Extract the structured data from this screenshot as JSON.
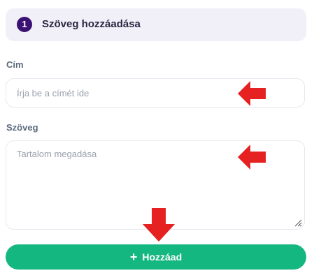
{
  "form": {
    "step_number": "1",
    "title": "Szöveg hozzáadása",
    "title_label": "Cím",
    "title_placeholder": "Írja be a címét ide",
    "text_label": "Szöveg",
    "text_placeholder": "Tartalom megadása",
    "submit_label": "Hozzáad",
    "submit_icon": "plus-icon"
  },
  "colors": {
    "accent_green": "#14b77f",
    "badge_purple": "#3b1274",
    "header_bg": "#f1eff8",
    "arrow_red": "#e52121"
  }
}
